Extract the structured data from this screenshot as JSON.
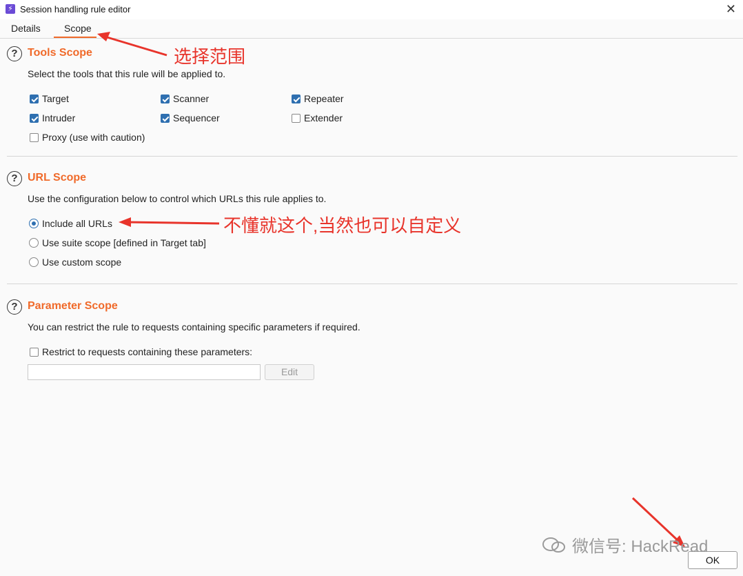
{
  "window": {
    "title": "Session handling rule editor",
    "close_glyph": "✕",
    "app_icon": "lightning-icon"
  },
  "tabs": [
    {
      "label": "Details"
    },
    {
      "label": "Scope"
    }
  ],
  "tools_scope": {
    "title": "Tools Scope",
    "description": "Select the tools that this rule will be applied to.",
    "options": [
      {
        "label": "Target",
        "checked": true
      },
      {
        "label": "Scanner",
        "checked": true
      },
      {
        "label": "Repeater",
        "checked": true
      },
      {
        "label": "Intruder",
        "checked": true
      },
      {
        "label": "Sequencer",
        "checked": true
      },
      {
        "label": "Extender",
        "checked": false
      },
      {
        "label": "Proxy (use with caution)",
        "checked": false
      }
    ]
  },
  "url_scope": {
    "title": "URL Scope",
    "description": "Use the configuration below to control which URLs this rule applies to.",
    "options": [
      {
        "label": "Include all URLs",
        "selected": true
      },
      {
        "label": "Use suite scope [defined in Target tab]",
        "selected": false
      },
      {
        "label": "Use custom scope",
        "selected": false
      }
    ]
  },
  "parameter_scope": {
    "title": "Parameter Scope",
    "description": "You can restrict the rule to requests containing specific parameters if required.",
    "restrict_label": "Restrict to requests containing these parameters:",
    "restrict_checked": false,
    "input_value": "",
    "edit_label": "Edit"
  },
  "help_glyph": "?",
  "footer": {
    "ok_label": "OK"
  },
  "annotations": {
    "scope_note": "选择范围",
    "url_note": "不懂就这个,当然也可以自定义",
    "color": "#e8342b"
  },
  "watermark": {
    "text": "微信号: HackRead"
  },
  "colors": {
    "accent": "#f06a2a",
    "checkbox": "#2e6fb0"
  }
}
